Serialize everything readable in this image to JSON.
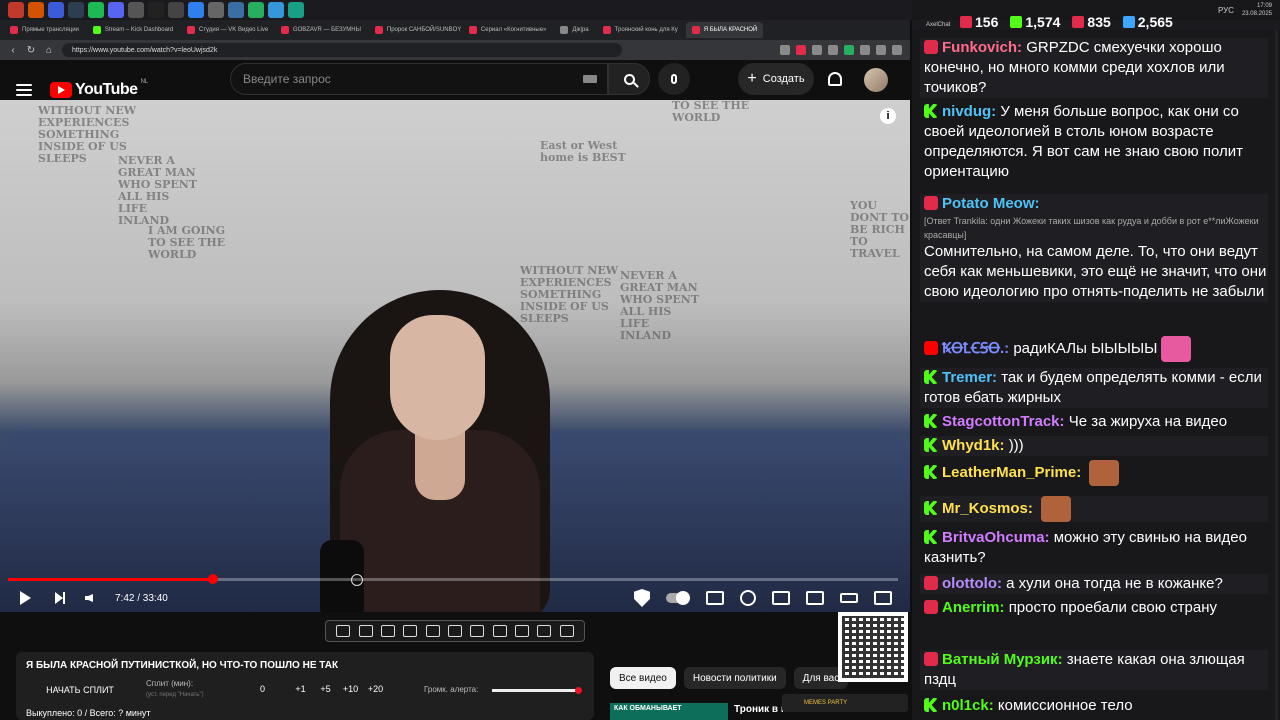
{
  "taskbar": {
    "lang": "РУС",
    "time": "17:09",
    "date": "23.08.2025"
  },
  "browser": {
    "tabs": [
      {
        "label": "Прямые трансляции",
        "color": "#e22b4b"
      },
      {
        "label": "Stream – Kick Dashboard",
        "color": "#53fc18"
      },
      {
        "label": "Студия — VK Видео Live",
        "color": "#e22b4b"
      },
      {
        "label": "GOBZAVR — БЕЗУМНЫ",
        "color": "#e22b4b"
      },
      {
        "label": "Пророк САНБОЙ/SUNBOY",
        "color": "#e22b4b"
      },
      {
        "label": "Сериал «Когнитивные»",
        "color": "#e22b4b"
      },
      {
        "label": "Дiк|ра",
        "color": "#888888"
      },
      {
        "label": "Троянский конь для Ку",
        "color": "#e22b4b"
      },
      {
        "label": "Я БЫЛА КРАСНОЙ",
        "color": "#e22b4b",
        "active": true
      }
    ],
    "url": "https://www.youtube.com/watch?v=leoUwjsd2k"
  },
  "youtube": {
    "logo_text": "YouTube",
    "region": "NL",
    "search_placeholder": "Введите запрос",
    "create_label": "Создать",
    "info_label": "i",
    "player": {
      "time": "7:42 / 33:40",
      "progress": 0.23
    },
    "wall_text": [
      "WITHOUT NEW EXPERIENCES SOMETHING INSIDE OF US SLEEPS",
      "NEVER A GREAT MAN WHO SPENT ALL HIS LIFE INLAND",
      "I AM GOING TO SEE THE WORLD",
      "East or West home is BEST",
      "TO SEE THE WORLD",
      "YOU DONT TO BE RICH TO TRAVEL"
    ],
    "chips": [
      "Все видео",
      "Новости политики",
      "Для вас"
    ],
    "rec": {
      "thumb_text": "КАК ОБМАНЫВАЕТ",
      "title": "Троник в к"
    }
  },
  "split": {
    "title": "Я БЫЛА КРАСНОЙ ПУТИНИСТКОЙ, НО ЧТО-ТО ПОШЛО НЕ ТАК",
    "start_label": "НАЧАТЬ СПЛИТ",
    "split_label": "Сплит (мин):",
    "split_hint": "(уст. перед \"Начать\")",
    "value": "0",
    "increments": [
      "+1",
      "+5",
      "+10",
      "+20"
    ],
    "alert_label": "Громк. алерта:",
    "alert_volume": 1.0,
    "stats": "Выкуплено: 0 / Всего: ? минут"
  },
  "overlay": {
    "meme_text": "MEMES PARTY"
  },
  "chat": {
    "app_title": "AxelChat",
    "stats": [
      {
        "value": "156",
        "color": "#e22b4b"
      },
      {
        "value": "1,574",
        "color": "#53fc18"
      },
      {
        "value": "835",
        "color": "#e22b4b"
      },
      {
        "value": "2,565",
        "color": "#3ea6ff"
      }
    ],
    "messages": [
      {
        "platform": "live",
        "user": "Funkovich:",
        "user_color": "#ff6b8b",
        "text": "GRPZDC смехуечки хорошо конечно, но много комми среди хохлов или точиков?",
        "bold_prefix": true
      },
      {
        "platform": "kick",
        "user": "nivdug:",
        "user_color": "#4fc3f7",
        "text": "У меня больше вопрос, как они со своей идеологией в столь юном возрасте определяются. Я вот сам не знаю свою полит ориентацию"
      },
      {
        "platform": "live",
        "user": "Potato Meow:",
        "user_color": "#4fc3f7",
        "reply": "[Ответ Trankila: одни Жожеки таких шизов как рудуа и добби в рот е**лиЖожеки красавцы]",
        "text": "Сомнительно, на самом деле. То, что они ведут себя как меньшевики, это ещё не значит, что они свою идеологию про отнять-поделить не забыли"
      },
      {
        "platform": "yt",
        "user": "ꝄꝊꝈꞒꞨꝊ.:",
        "user_color": "#7c8cff",
        "text": "радиКАЛы ЫЫЫЫЫ"
      },
      {
        "platform": "kick",
        "user": "Tremer:",
        "user_color": "#4fc3f7",
        "text": "так и будем определять комми - если готов ебать жирных"
      },
      {
        "platform": "kick",
        "user": "StagcottonTrack:",
        "user_color": "#d17cff",
        "text": "Че за жируха на видео"
      },
      {
        "platform": "kick",
        "user": "Whyd1k:",
        "user_color": "#ffe14d",
        "text": ")))"
      },
      {
        "platform": "kick",
        "user": "LeatherMan_Prime:",
        "user_color": "#ffe14d",
        "text": ""
      },
      {
        "platform": "kick",
        "user": "Mr_Kosmos:",
        "user_color": "#ffe14d",
        "text": ""
      },
      {
        "platform": "kick",
        "user": "BritvaOhcuma:",
        "user_color": "#d17cff",
        "text": "можно эту свинью на видео казнить?"
      },
      {
        "platform": "live",
        "user": "olottolo:",
        "user_color": "#b78cff",
        "text": "а хули она тогда не в кожанке?"
      },
      {
        "platform": "live",
        "user": "Anerrim:",
        "user_color": "#53fc18",
        "text": "просто проебали свою страну"
      },
      {
        "platform": "live",
        "user": "Ватный Мурзик:",
        "user_color": "#53fc18",
        "text": "знаете какая она злющая пздц"
      },
      {
        "platform": "kick",
        "user": "n0l1ck:",
        "user_color": "#53fc18",
        "text": "комиссионное тело"
      }
    ]
  }
}
